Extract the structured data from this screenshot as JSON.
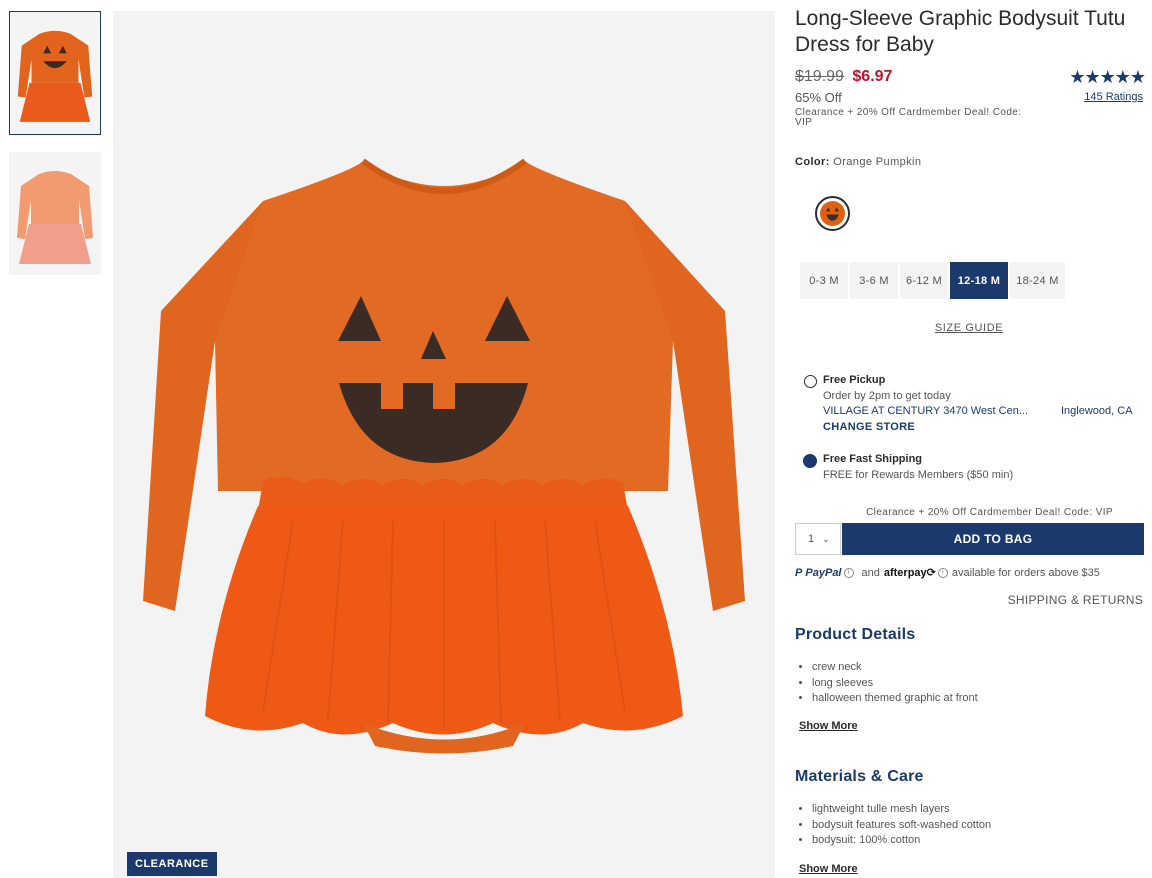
{
  "thumbnails": [
    {
      "label": "",
      "selected": true
    },
    {
      "label": "",
      "selected": false
    }
  ],
  "badge": {
    "clearance": "CLEARANCE"
  },
  "product": {
    "title": "Long-Sleeve Graphic Bodysuit Tutu Dress for Baby",
    "price_old": "$19.99",
    "price_new": "$6.97",
    "percent_off": "65% Off",
    "deal": "Clearance + 20% Off Cardmember Deal! Code: VIP",
    "stars": "★★★★★",
    "ratings": "145 Ratings",
    "rating_value": 5,
    "color_label": "Color:",
    "color_value": "Orange Pumpkin"
  },
  "sizes": [
    "0-3 M",
    "3-6 M",
    "6-12 M",
    "12-18 M",
    "18-24 M"
  ],
  "selected_size": "12-18 M",
  "size_guide": "SIZE GUIDE",
  "fulfillment": {
    "pickup_title": "Free Pickup",
    "pickup_sub": "Order by 2pm to get today",
    "store_name": "VILLAGE AT CENTURY 3470 West Cen...",
    "store_city": "Inglewood, CA",
    "change_store": "CHANGE STORE",
    "shipping_title": "Free Fast Shipping",
    "shipping_sub": "FREE for Rewards Members ($50 min)"
  },
  "cart": {
    "deal_line": "Clearance + 20% Off Cardmember Deal! Code: VIP",
    "quantity": "1",
    "add_to_bag": "ADD TO BAG"
  },
  "payment": {
    "paypal": "PayPal",
    "and": "and",
    "afterpay": "afterpay",
    "available": "available for orders above $35"
  },
  "shipping_returns": "SHIPPING & RETURNS",
  "details": {
    "title": "Product Details",
    "items": [
      "crew neck",
      "long sleeves",
      "halloween themed graphic at front"
    ],
    "show_more": "Show More"
  },
  "materials": {
    "title": "Materials & Care",
    "items": [
      "lightweight tulle mesh layers",
      "bodysuit features soft-washed cotton",
      "bodysuit: 100% cotton"
    ],
    "show_more": "Show More"
  },
  "colors": {
    "navy": "#1b3a6b",
    "sale_red": "#c8102e",
    "orange": "#e06010"
  }
}
